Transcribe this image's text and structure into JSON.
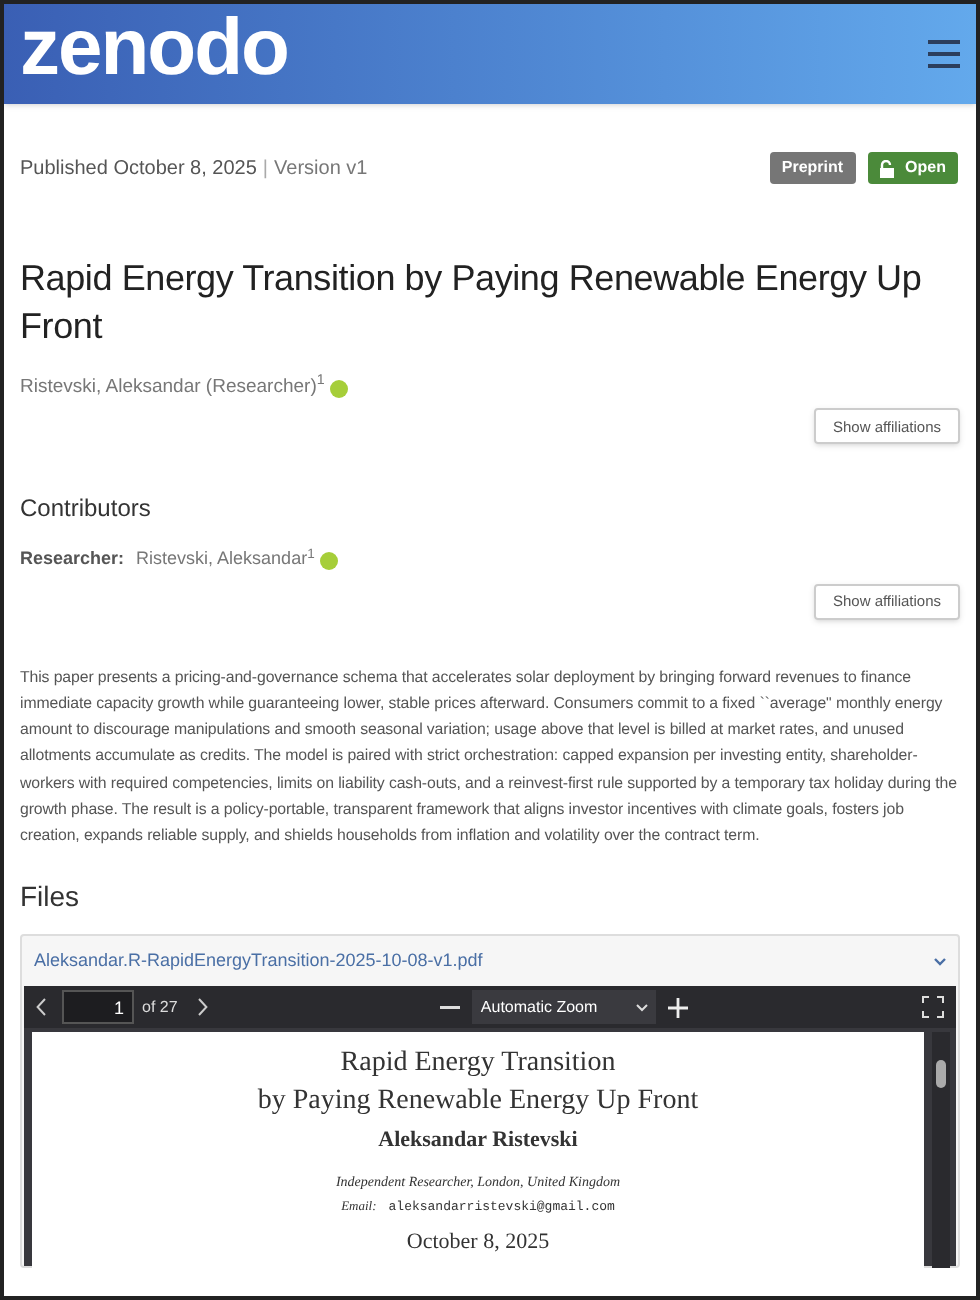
{
  "header": {
    "logo": "zenodo"
  },
  "meta": {
    "published": "Published October 8, 2025",
    "separator": "|",
    "version": "Version v1"
  },
  "badges": [
    {
      "kind": "type",
      "label": "Preprint"
    },
    {
      "kind": "access",
      "label": "Open"
    }
  ],
  "title": "Rapid Energy Transition by Paying Renewable Energy Up Front",
  "creators": [
    {
      "name": "Ristevski, Aleksandar (Researcher)",
      "sup": "1"
    }
  ],
  "creators_button": "Show affiliations",
  "contributors": {
    "heading": "Contributors",
    "role": "Researcher:",
    "name": "Ristevski, Aleksandar",
    "sup": "1",
    "button": "Show affiliations"
  },
  "abstract": "This paper presents a pricing-and-governance schema that accelerates solar deployment by bringing forward revenues to finance immediate capacity growth while guaranteeing lower, stable prices afterward. Consumers commit to a fixed ``average\" monthly energy amount to discourage manipulations and smooth seasonal variation; usage above that level is billed at market rates, and unused allotments accumulate as credits. The model is paired with strict orchestration: capped expansion per investing entity, shareholder-workers with required competencies, limits on liability cash-outs, and a reinvest-first rule supported by a temporary tax holiday during the growth phase. The result is a policy-portable, transparent framework that aligns investor incentives with climate goals, fosters job creation, expands reliable supply, and shields households from inflation and volatility over the contract term.",
  "files": {
    "heading": "Files",
    "filename": "Aleksandar.R-RapidEnergyTransition-2025-10-08-v1.pdf",
    "expanded": true,
    "viewer": {
      "page": "1",
      "of": "of 27",
      "zoom": "Automatic Zoom",
      "document": {
        "title_lines": [
          "Rapid Energy Transition",
          "by Paying Renewable Energy Up Front"
        ],
        "author": "Aleksandar Ristevski",
        "affiliation": "Independent Researcher, London, United Kingdom",
        "email_label": "Email:",
        "email": "aleksandarristevski@gmail.com",
        "date": "October 8, 2025"
      }
    }
  }
}
